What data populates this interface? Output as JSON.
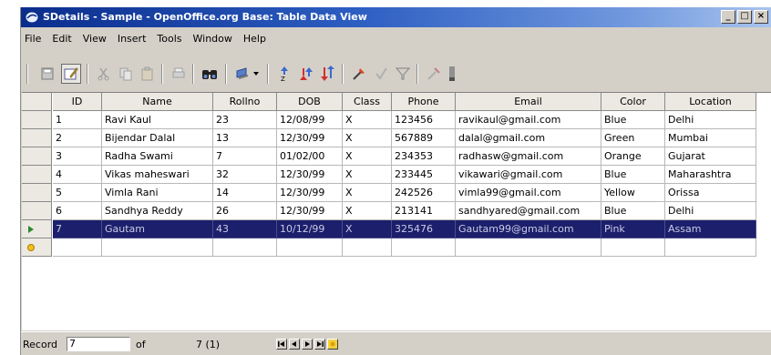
{
  "window": {
    "title": "SDetails - Sample - OpenOffice.org Base: Table Data View",
    "controls": [
      "_",
      "□",
      "×"
    ]
  },
  "menu": [
    "File",
    "Edit",
    "View",
    "Insert",
    "Tools",
    "Window",
    "Help"
  ],
  "toolbar": {
    "icons": [
      "save-icon",
      "edit-data-icon",
      "cut-icon",
      "copy-icon",
      "paste-icon",
      "print-icon",
      "find-icon",
      "refresh-icon",
      "sort-ascending-icon",
      "sort-descending-icon",
      "sort-icon",
      "autofilter-icon",
      "standard-filter-icon",
      "apply-filter-icon",
      "remove-filter-icon",
      "data-to-text-icon"
    ]
  },
  "table": {
    "columns": [
      "ID",
      "Name",
      "Rollno",
      "DOB",
      "Class",
      "Phone",
      "Email",
      "Color",
      "Location"
    ],
    "rows": [
      [
        "1",
        "Ravi Kaul",
        "23",
        "12/08/99",
        "X",
        "123456",
        "ravikaul@gmail.com",
        "Blue",
        "Delhi"
      ],
      [
        "2",
        "Bijendar Dalal",
        "13",
        "12/30/99",
        "X",
        "567889",
        "dalal@gmail.com",
        "Green",
        "Mumbai"
      ],
      [
        "3",
        "Radha Swami",
        "7",
        "01/02/00",
        "X",
        "234353",
        "radhasw@gmail.com",
        "Orange",
        "Gujarat"
      ],
      [
        "4",
        "Vikas maheswari",
        "32",
        "12/30/99",
        "X",
        "233445",
        "vikawari@gmail.com",
        "Blue",
        "Maharashtra"
      ],
      [
        "5",
        "Vimla Rani",
        "14",
        "12/30/99",
        "X",
        "242526",
        "vimla99@gmail.com",
        "Yellow",
        "Orissa"
      ],
      [
        "6",
        "Sandhya Reddy",
        "26",
        "12/30/99",
        "X",
        "213141",
        "sandhyared@gmail.com",
        "Blue",
        "Delhi"
      ],
      [
        "7",
        "Gautam",
        "43",
        "10/12/99",
        "X",
        "325476",
        "Gautam99@gmail.com",
        "Pink",
        "Assam"
      ]
    ],
    "selected_row": 6
  },
  "status": {
    "record_label": "Record",
    "record_value": "7",
    "of_label": "of",
    "count": "7 (1)"
  }
}
